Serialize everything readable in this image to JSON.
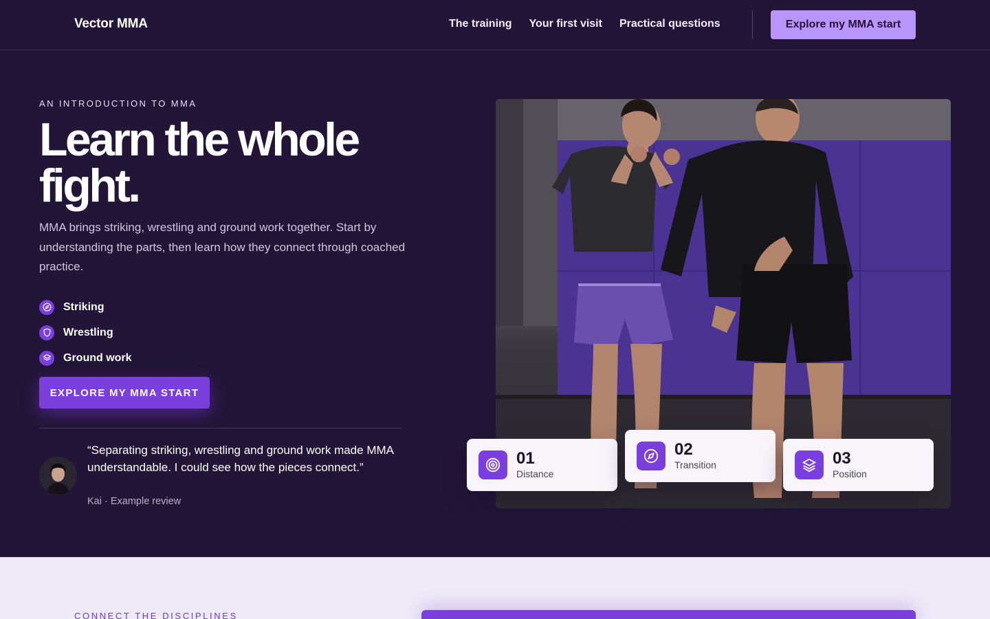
{
  "header": {
    "brand": "Vector MMA",
    "nav": [
      {
        "label": "The training"
      },
      {
        "label": "Your first visit"
      },
      {
        "label": "Practical questions"
      }
    ],
    "cta_label": "Explore my MMA start"
  },
  "hero": {
    "eyebrow": "AN INTRODUCTION TO MMA",
    "title_line1": "Learn the whole",
    "title_line2": "fight.",
    "copy": "MMA brings striking, wrestling and ground work together. Start by understanding the parts, then learn how they connect through coached practice.",
    "features": [
      {
        "label": "Striking",
        "icon": "compass-icon"
      },
      {
        "label": "Wrestling",
        "icon": "shield-icon"
      },
      {
        "label": "Ground work",
        "icon": "layers-icon"
      }
    ],
    "cta_label": "EXPLORE MY MMA START",
    "testimonial": {
      "quote": "“Separating striking, wrestling and ground work made MMA understandable. I could see how the pieces connect.”",
      "meta": "Kai · Example review"
    }
  },
  "stats": [
    {
      "number": "01",
      "label": "Distance",
      "icon": "target-icon"
    },
    {
      "number": "02",
      "label": "Transition",
      "icon": "compass-icon"
    },
    {
      "number": "03",
      "label": "Position",
      "icon": "layers-icon"
    }
  ],
  "lower": {
    "eyebrow": "CONNECT THE DISCIPLINES"
  },
  "colors": {
    "background": "#231537",
    "accent": "#7b3fe0",
    "accent_light": "#b894fb",
    "lower_bg": "#eeeaf7"
  }
}
